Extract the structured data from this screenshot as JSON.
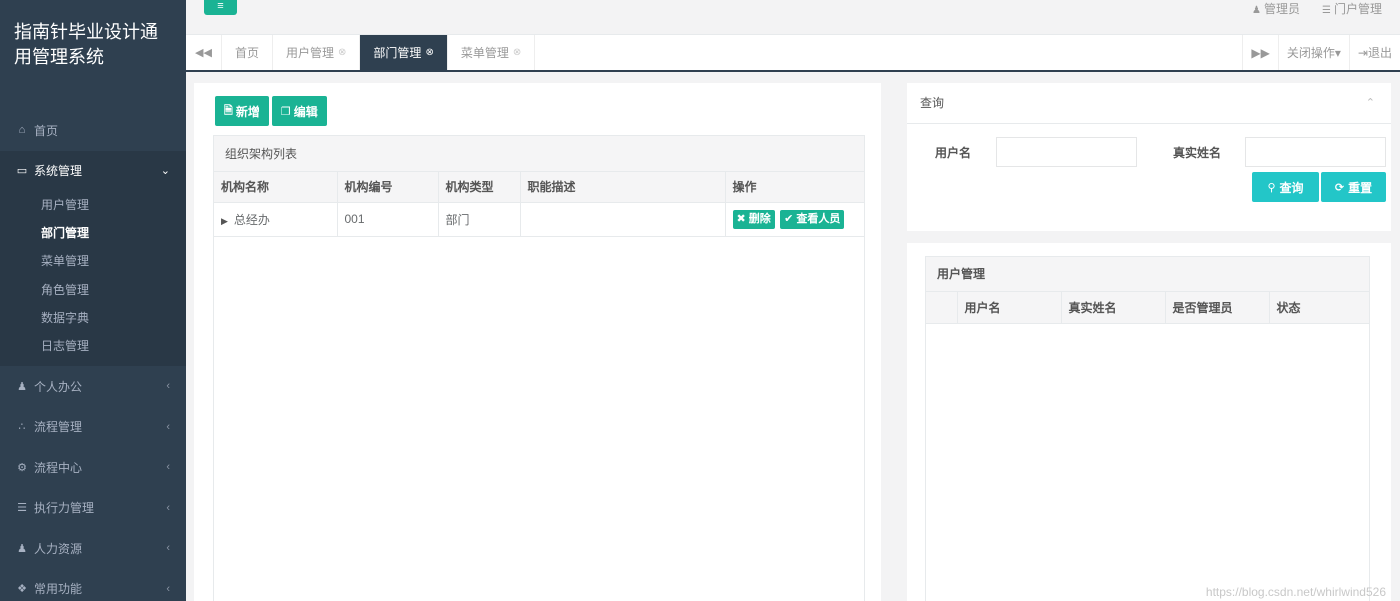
{
  "app_title": "指南针毕业设计通用管理系统",
  "sidebar": {
    "items": [
      {
        "label": "首页",
        "icon": "home-icon",
        "glyph": "⌂"
      },
      {
        "label": "系统管理",
        "icon": "monitor-icon",
        "glyph": "▭"
      },
      {
        "label": "个人办公",
        "icon": "user-icon",
        "glyph": "♟"
      },
      {
        "label": "流程管理",
        "icon": "share-icon",
        "glyph": "∴"
      },
      {
        "label": "流程中心",
        "icon": "gear-icon",
        "glyph": "⚙"
      },
      {
        "label": "执行力管理",
        "icon": "server-icon",
        "glyph": "☰"
      },
      {
        "label": "人力资源",
        "icon": "user-plus-icon",
        "glyph": "♟"
      },
      {
        "label": "常用功能",
        "icon": "cubes-icon",
        "glyph": "❖"
      }
    ],
    "submenu": [
      "用户管理",
      "部门管理",
      "菜单管理",
      "角色管理",
      "数据字典",
      "日志管理"
    ]
  },
  "topbar": {
    "menu_glyph": "≡",
    "admin_label": "管理员",
    "portal_label": "门户管理"
  },
  "tabs": {
    "items": [
      {
        "label": "首页"
      },
      {
        "label": "用户管理"
      },
      {
        "label": "部门管理"
      },
      {
        "label": "菜单管理"
      }
    ],
    "close_ops_label": "关闭操作",
    "logout_label": "退出"
  },
  "dept": {
    "add_label": "新增",
    "edit_label": "编辑",
    "list_title": "组织架构列表",
    "columns": [
      "机构名称",
      "机构编号",
      "机构类型",
      "职能描述",
      "操作"
    ],
    "rows": [
      {
        "name": "总经办",
        "code": "001",
        "type": "部门",
        "desc": ""
      }
    ],
    "delete_label": "删除",
    "view_members_label": "查看人员"
  },
  "query": {
    "title": "查询",
    "username_label": "用户名",
    "username_value": "",
    "realname_label": "真实姓名",
    "realname_value": "",
    "search_label": "查询",
    "reset_label": "重置"
  },
  "users": {
    "title": "用户管理",
    "columns": [
      "",
      "用户名",
      "真实姓名",
      "是否管理员",
      "状态"
    ]
  },
  "watermark": "https://blog.csdn.net/whirlwind526"
}
